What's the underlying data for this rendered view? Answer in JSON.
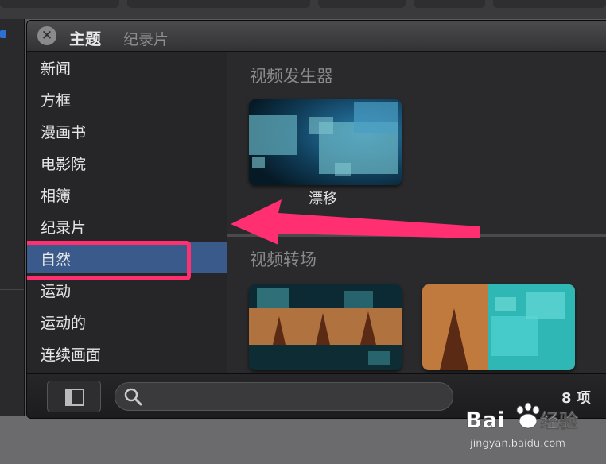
{
  "title_bar": {
    "title": "主题",
    "subtitle": "纪录片"
  },
  "sidebar": {
    "items": [
      "新闻",
      "方框",
      "漫画书",
      "电影院",
      "相簿",
      "纪录片",
      "自然",
      "运动",
      "运动的",
      "连续画面"
    ],
    "selected_index": 5
  },
  "content": {
    "sections": [
      {
        "title": "视频发生器",
        "items": [
          {
            "label": "漂移"
          }
        ]
      },
      {
        "title": "视频转场",
        "items": [
          {
            "label": ""
          },
          {
            "label": ""
          }
        ]
      }
    ]
  },
  "bottom_bar": {
    "count_label": "8 项"
  },
  "watermark": {
    "brand": "Baidu经验",
    "url": "jingyan.baidu.com"
  },
  "colors": {
    "selection": "#3a5a8c",
    "annotation": "#ff2f72",
    "accent_blue": "#2f6fd1"
  }
}
